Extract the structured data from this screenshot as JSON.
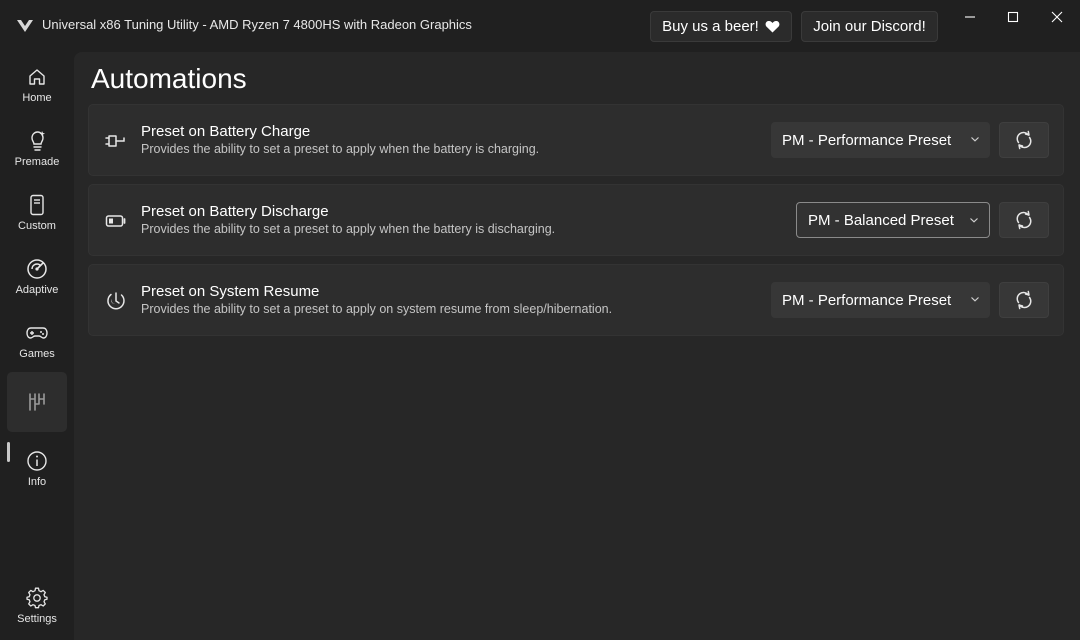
{
  "window": {
    "title": "Universal x86 Tuning Utility - AMD Ryzen 7 4800HS with Radeon Graphics",
    "logo_icon": "uxtu-logo-icon"
  },
  "header": {
    "beer_label": "Buy us a beer!",
    "beer_icon": "heart-icon",
    "discord_label": "Join our Discord!"
  },
  "sidebar": {
    "items": [
      {
        "label": "Home",
        "icon": "home-icon"
      },
      {
        "label": "Premade",
        "icon": "premade-icon"
      },
      {
        "label": "Custom",
        "icon": "custom-icon"
      },
      {
        "label": "Adaptive",
        "icon": "adaptive-icon"
      },
      {
        "label": "Games",
        "icon": "gamepad-icon"
      },
      {
        "label": "",
        "icon": "automations-icon",
        "active": true
      },
      {
        "label": "Info",
        "icon": "info-icon"
      },
      {
        "label": "Settings",
        "icon": "gear-icon"
      }
    ]
  },
  "page": {
    "title": "Automations",
    "cards": [
      {
        "title": "Preset on Battery Charge",
        "description": "Provides the ability to set a preset to apply when the battery is charging.",
        "selected": "PM - Performance Preset",
        "icon": "plug-icon"
      },
      {
        "title": "Preset on Battery Discharge",
        "description": "Provides the ability to set a preset to apply when the battery is discharging.",
        "selected": "PM - Balanced Preset",
        "icon": "battery-icon"
      },
      {
        "title": "Preset on System Resume",
        "description": "Provides the ability to set a preset to apply on system resume from sleep/hibernation.",
        "selected": "PM - Performance Preset",
        "icon": "resume-icon"
      }
    ]
  }
}
